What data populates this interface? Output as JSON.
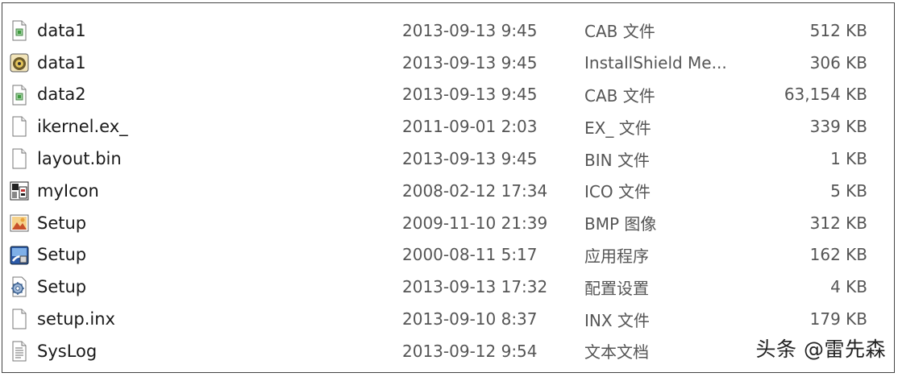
{
  "files": [
    {
      "name": "data1",
      "date": "2013-09-13 9:45",
      "type": "CAB 文件",
      "size": "512 KB",
      "icon": "cab-file-icon"
    },
    {
      "name": "data1",
      "date": "2013-09-13 9:45",
      "type": "InstallShield Me...",
      "size": "306 KB",
      "icon": "installshield-icon"
    },
    {
      "name": "data2",
      "date": "2013-09-13 9:45",
      "type": "CAB 文件",
      "size": "63,154 KB",
      "icon": "cab-file-icon"
    },
    {
      "name": "ikernel.ex_",
      "date": "2011-09-01 2:03",
      "type": "EX_ 文件",
      "size": "339 KB",
      "icon": "blank-file-icon"
    },
    {
      "name": "layout.bin",
      "date": "2013-09-13 9:45",
      "type": "BIN 文件",
      "size": "1 KB",
      "icon": "blank-file-icon"
    },
    {
      "name": "myIcon",
      "date": "2008-02-12 17:34",
      "type": "ICO 文件",
      "size": "5 KB",
      "icon": "ico-file-icon"
    },
    {
      "name": "Setup",
      "date": "2009-11-10 21:39",
      "type": "BMP 图像",
      "size": "312 KB",
      "icon": "bmp-image-icon"
    },
    {
      "name": "Setup",
      "date": "2000-08-11 5:17",
      "type": "应用程序",
      "size": "162 KB",
      "icon": "setup-exe-icon"
    },
    {
      "name": "Setup",
      "date": "2013-09-13 17:32",
      "type": "配置设置",
      "size": "4 KB",
      "icon": "config-settings-icon"
    },
    {
      "name": "setup.inx",
      "date": "2013-09-10 8:37",
      "type": "INX 文件",
      "size": "179 KB",
      "icon": "blank-file-icon"
    },
    {
      "name": "SysLog",
      "date": "2013-09-12 9:54",
      "type": "文本文档",
      "size": "",
      "icon": "text-document-icon"
    }
  ],
  "watermark": "头条 @雷先森"
}
